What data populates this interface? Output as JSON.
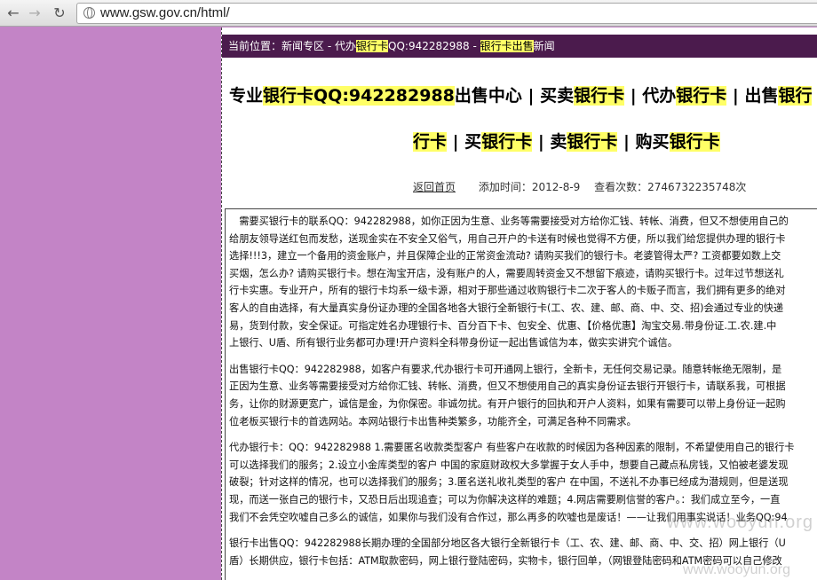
{
  "browser": {
    "url": "www.gsw.gov.cn/html/"
  },
  "breadcrumb": {
    "prefix": "当前位置：",
    "home": "新闻专区",
    "sep": " - ",
    "item_pre": "代办",
    "item_hl": "银行卡",
    "item_post": "QQ:942282988",
    "sep2": " - ",
    "cat_hl": "银行卡出售",
    "cat_post": "新闻"
  },
  "title": {
    "line1": [
      {
        "t": "专业",
        "h": false
      },
      {
        "t": "银行卡QQ:942282988",
        "h": true
      },
      {
        "t": "出售中心 | 买卖",
        "h": false
      },
      {
        "t": "银行卡",
        "h": true
      },
      {
        "t": " | 代办",
        "h": false
      },
      {
        "t": "银行卡",
        "h": true
      },
      {
        "t": " | 出售",
        "h": false
      },
      {
        "t": "银行",
        "h": true
      }
    ],
    "line2": [
      {
        "t": "行卡",
        "h": true
      },
      {
        "t": " | 买",
        "h": false
      },
      {
        "t": "银行卡",
        "h": true
      },
      {
        "t": " | 卖",
        "h": false
      },
      {
        "t": "银行卡",
        "h": true
      },
      {
        "t": " | 购买",
        "h": false
      },
      {
        "t": "银行卡",
        "h": true
      }
    ]
  },
  "meta": {
    "back_link": "返回首页",
    "added_label": "添加时间：2012-8-9",
    "views_label": "查看次数：2746732235748次"
  },
  "paragraphs": [
    [
      "　需要买银行卡的联系QQ：942282988，如你正因为生意、业务等需要接受对方给你汇钱、转帐、消费，但又不想使用自己的",
      "给朋友领导送红包而发愁，送现金实在不安全又俗气，用自己开户的卡送有时候也觉得不方便，所以我们给您提供办理的银行卡",
      "选择!!!3，建立一个备用的资金账户，并且保障企业的正常资金流动? 请购买我们的银行卡。老婆管得太严? 工资都要如数上交",
      "买烟，怎么办? 请购买银行卡。想在淘宝开店，没有账户的人，需要周转资金又不想留下痕迹，请购买银行卡。过年过节想送礼",
      "行卡实惠。专业开户，所有的银行卡均系一级卡源，相对于那些通过收购银行卡二次于客人的卡贩子而言，我们拥有更多的绝对",
      "客人的自由选择，有大量真实身份证办理的全国各地各大银行全新银行卡(工、农、建、邮、商、中、交、招)会通过专业的快递",
      "易，货到付款，安全保证。可指定姓名办理银行卡、百分百下卡、包安全、优惠、【价格优惠】淘宝交易.带身份证.工.农.建.中",
      "上银行、U盾、所有银行业务都可办理!开户资料全科带身份证一起出售诚信为本，做实实讲究个诚信。"
    ],
    [
      "出售银行卡QQ：942282988，如客户有要求,代办银行卡可开通网上银行，全新卡，无任何交易记录。随意转帐绝无限制，是",
      "正因为生意、业务等需要接受对方给你汇钱、转帐、消费，但又不想使用自己的真实身份证去银行开银行卡，请联系我，可根据",
      "务，让你的财源更宽广，诚信是金，为你保密。非诚勿扰。有开户银行的回执和开户人资料，如果有需要可以带上身份证一起购",
      "位老板买银行卡的首选网站。本网站银行卡出售种类繁多，功能齐全，可满足各种不同需求。"
    ],
    [
      "代办银行卡：QQ：942282988 1.需要匿名收款类型客户 有些客户在收款的时候因为各种因素的限制，不希望使用自己的银行卡",
      "可以选择我们的服务；2.设立小金库类型的客户 中国的家庭财政权大多掌握于女人手中，想要自己藏点私房钱，又怕被老婆发现",
      "破裂；针对这样的情况，也可以选择我们的服务；3.匿名送礼收礼类型的客户 在中国，不送礼不办事已经成为潜规则，但是送现",
      "现，而送一张自己的银行卡，又恐日后出现追查；可以为你解决这样的难题；4.网店需要刷信誉的客户。：我们成立至今，一直",
      "我们不会凭空吹嘘自己多么的诚信，如果你与我们没有合作过，那么再多的吹嘘也是废话！——让我们用事实说话！业务QQ:94"
    ],
    [
      "银行卡出售QQ：942282988长期办理的全国部分地区各大银行全新银行卡（工、农、建、邮、商、中、交、招）网上银行（U",
      "盾）长期供应，银行卡包括：ATM取款密码，网上银行登陆密码，实物卡，银行回单，（网银登陆密码和ATM密码可以自己修改"
    ]
  ],
  "watermark": "www.wooyun.org",
  "watermark2": "www.wooyun.org"
}
